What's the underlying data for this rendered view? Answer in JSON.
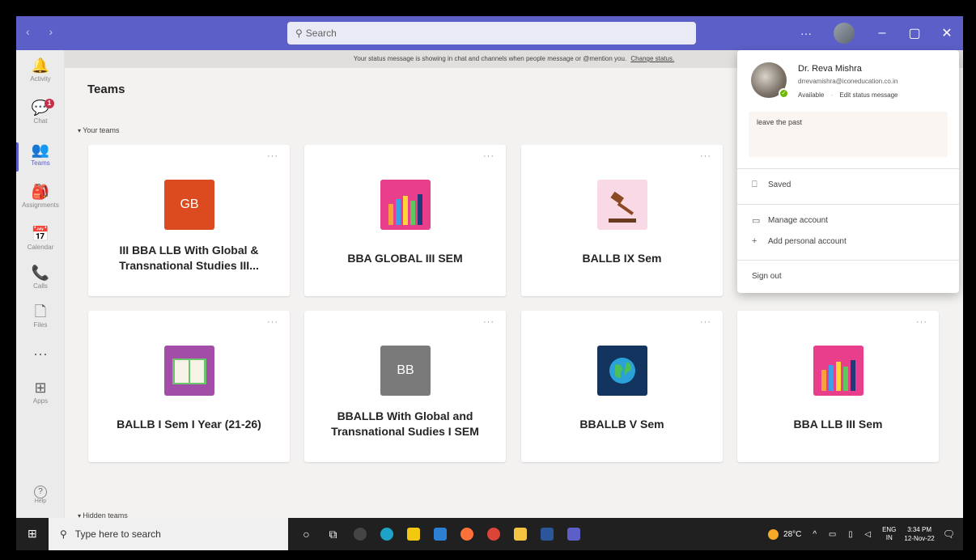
{
  "titlebar": {
    "nav": "‹ ›",
    "search_placeholder": "Search",
    "more": "···",
    "minimize": "–",
    "maximize": "▢",
    "close": "✕"
  },
  "banner": {
    "text": "Your status message is showing in chat and channels when people message or @mention you.",
    "link": "Change status."
  },
  "rail": [
    {
      "label": "Activity",
      "icon": "bell-icon",
      "glyph": "🔔"
    },
    {
      "label": "Chat",
      "icon": "chat-icon",
      "glyph": "💬",
      "badge": "1"
    },
    {
      "label": "Teams",
      "icon": "teams-icon",
      "glyph": "👥"
    },
    {
      "label": "Assignments",
      "icon": "assignments-icon",
      "glyph": "🎒"
    },
    {
      "label": "Calendar",
      "icon": "calendar-icon",
      "glyph": "📅"
    },
    {
      "label": "Calls",
      "icon": "phone-icon",
      "glyph": "📞"
    },
    {
      "label": "Files",
      "icon": "file-icon",
      "glyph": "🗋"
    },
    {
      "label": "",
      "icon": "more-icon",
      "glyph": "···"
    },
    {
      "label": "Apps",
      "icon": "apps-icon",
      "glyph": "⊞"
    }
  ],
  "help_label": "Help",
  "main": {
    "title": "Teams",
    "your_teams": "Your teams",
    "hidden_teams": "Hidden teams",
    "cards": [
      {
        "name": "III BBA LLB With Global & Transnational Studies III...",
        "tile": "GB",
        "color": "#dc4a1f",
        "kind": "initials"
      },
      {
        "name": "BBA GLOBAL III SEM",
        "tile": "",
        "color": "#e83e8c",
        "kind": "pencils"
      },
      {
        "name": "BALLB IX Sem",
        "tile": "",
        "color": "#f9d9e6",
        "kind": "gavel"
      },
      {
        "name": "BALLB I Sem I Year (21-26)",
        "tile": "",
        "color": "#a24ea8",
        "kind": "book"
      },
      {
        "name": "BBALLB With Global and Transnational Sudies I SEM",
        "tile": "BB",
        "color": "#7a7a7a",
        "kind": "initials"
      },
      {
        "name": "BBALLB V Sem",
        "tile": "",
        "color": "#12345e",
        "kind": "globe"
      },
      {
        "name": "BBA LLB III Sem",
        "tile": "",
        "color": "#e83e8c",
        "kind": "pencils"
      }
    ]
  },
  "profile": {
    "name": "Dr. Reva Mishra",
    "email": "drrevamishra@iconeducation.co.in",
    "availability": "Available",
    "edit_status": "Edit status message",
    "status_message": "leave the past",
    "saved": "Saved",
    "manage_account": "Manage account",
    "add_account": "Add personal account",
    "sign_out": "Sign out"
  },
  "taskbar": {
    "search_placeholder": "Type here to search",
    "temperature": "28°C",
    "lang_top": "ENG",
    "lang_bottom": "IN",
    "time": "3:34 PM",
    "date": "12-Nov-22"
  }
}
